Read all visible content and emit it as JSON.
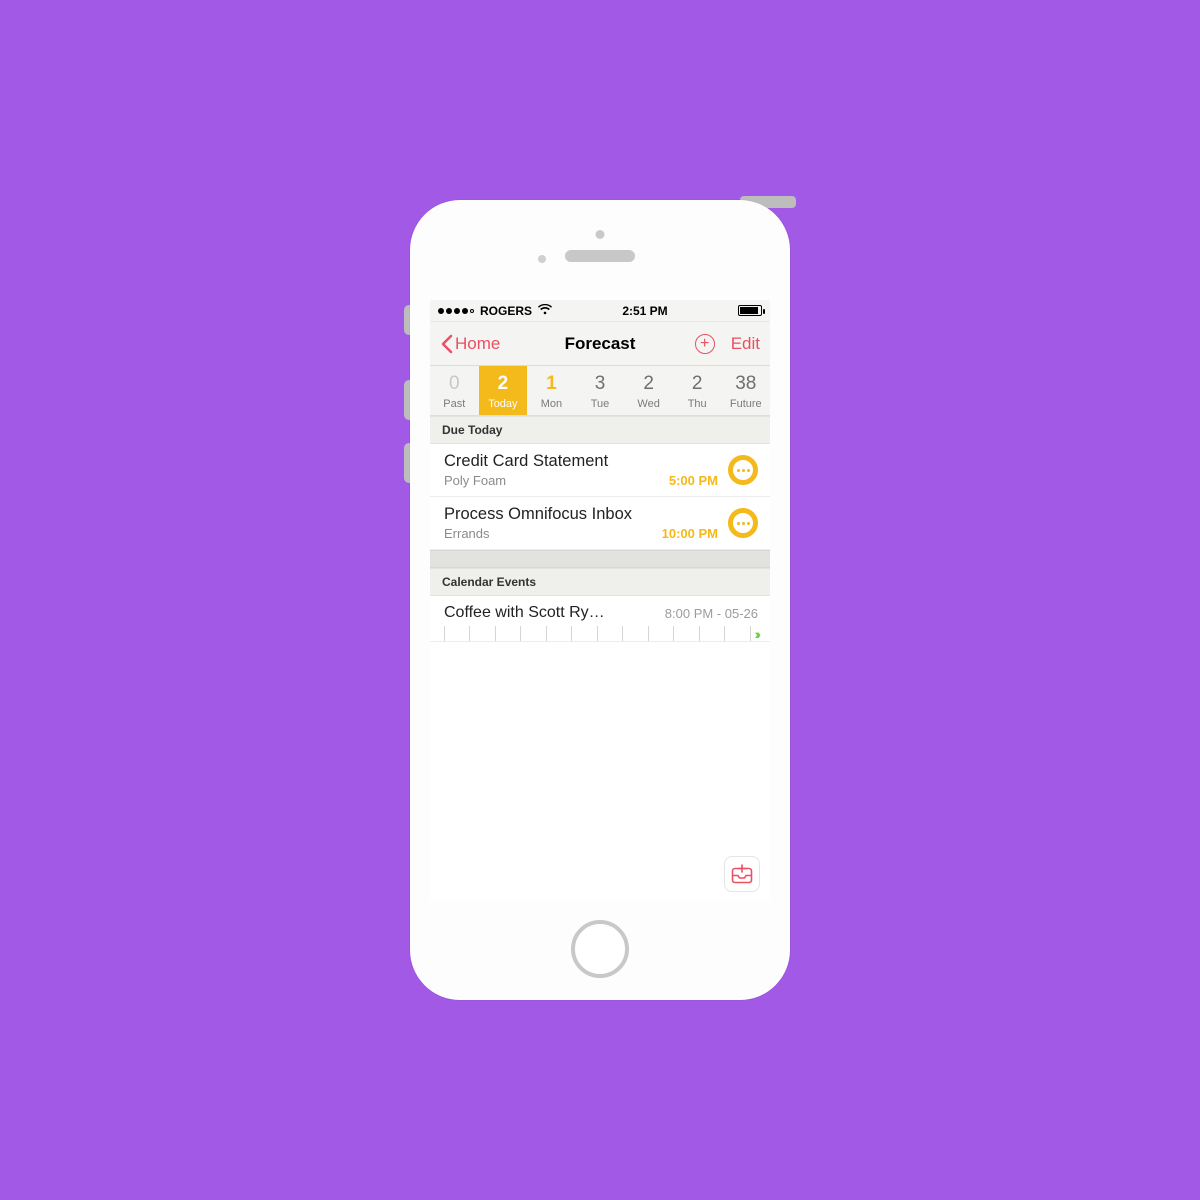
{
  "statusbar": {
    "carrier": "ROGERS",
    "time": "2:51 PM"
  },
  "nav": {
    "back": "Home",
    "title": "Forecast",
    "edit": "Edit"
  },
  "days": [
    {
      "count": "0",
      "label": "Past",
      "state": "past"
    },
    {
      "count": "2",
      "label": "Today",
      "state": "selected"
    },
    {
      "count": "1",
      "label": "Mon",
      "state": "highlight"
    },
    {
      "count": "3",
      "label": "Tue",
      "state": ""
    },
    {
      "count": "2",
      "label": "Wed",
      "state": ""
    },
    {
      "count": "2",
      "label": "Thu",
      "state": ""
    },
    {
      "count": "38",
      "label": "Future",
      "state": ""
    }
  ],
  "sections": {
    "due_today_header": "Due Today",
    "calendar_header": "Calendar Events"
  },
  "tasks": [
    {
      "title": "Credit Card Statement",
      "project": "Poly Foam",
      "due": "5:00 PM"
    },
    {
      "title": "Process Omnifocus Inbox",
      "project": "Errands",
      "due": "10:00 PM"
    }
  ],
  "events": [
    {
      "title": "Coffee with Scott Ry…",
      "time": "8:00 PM - 05-26"
    }
  ],
  "colors": {
    "accent": "#eb4f62",
    "due": "#f4b91a",
    "timeline_arrow": "#6bcf3e"
  }
}
